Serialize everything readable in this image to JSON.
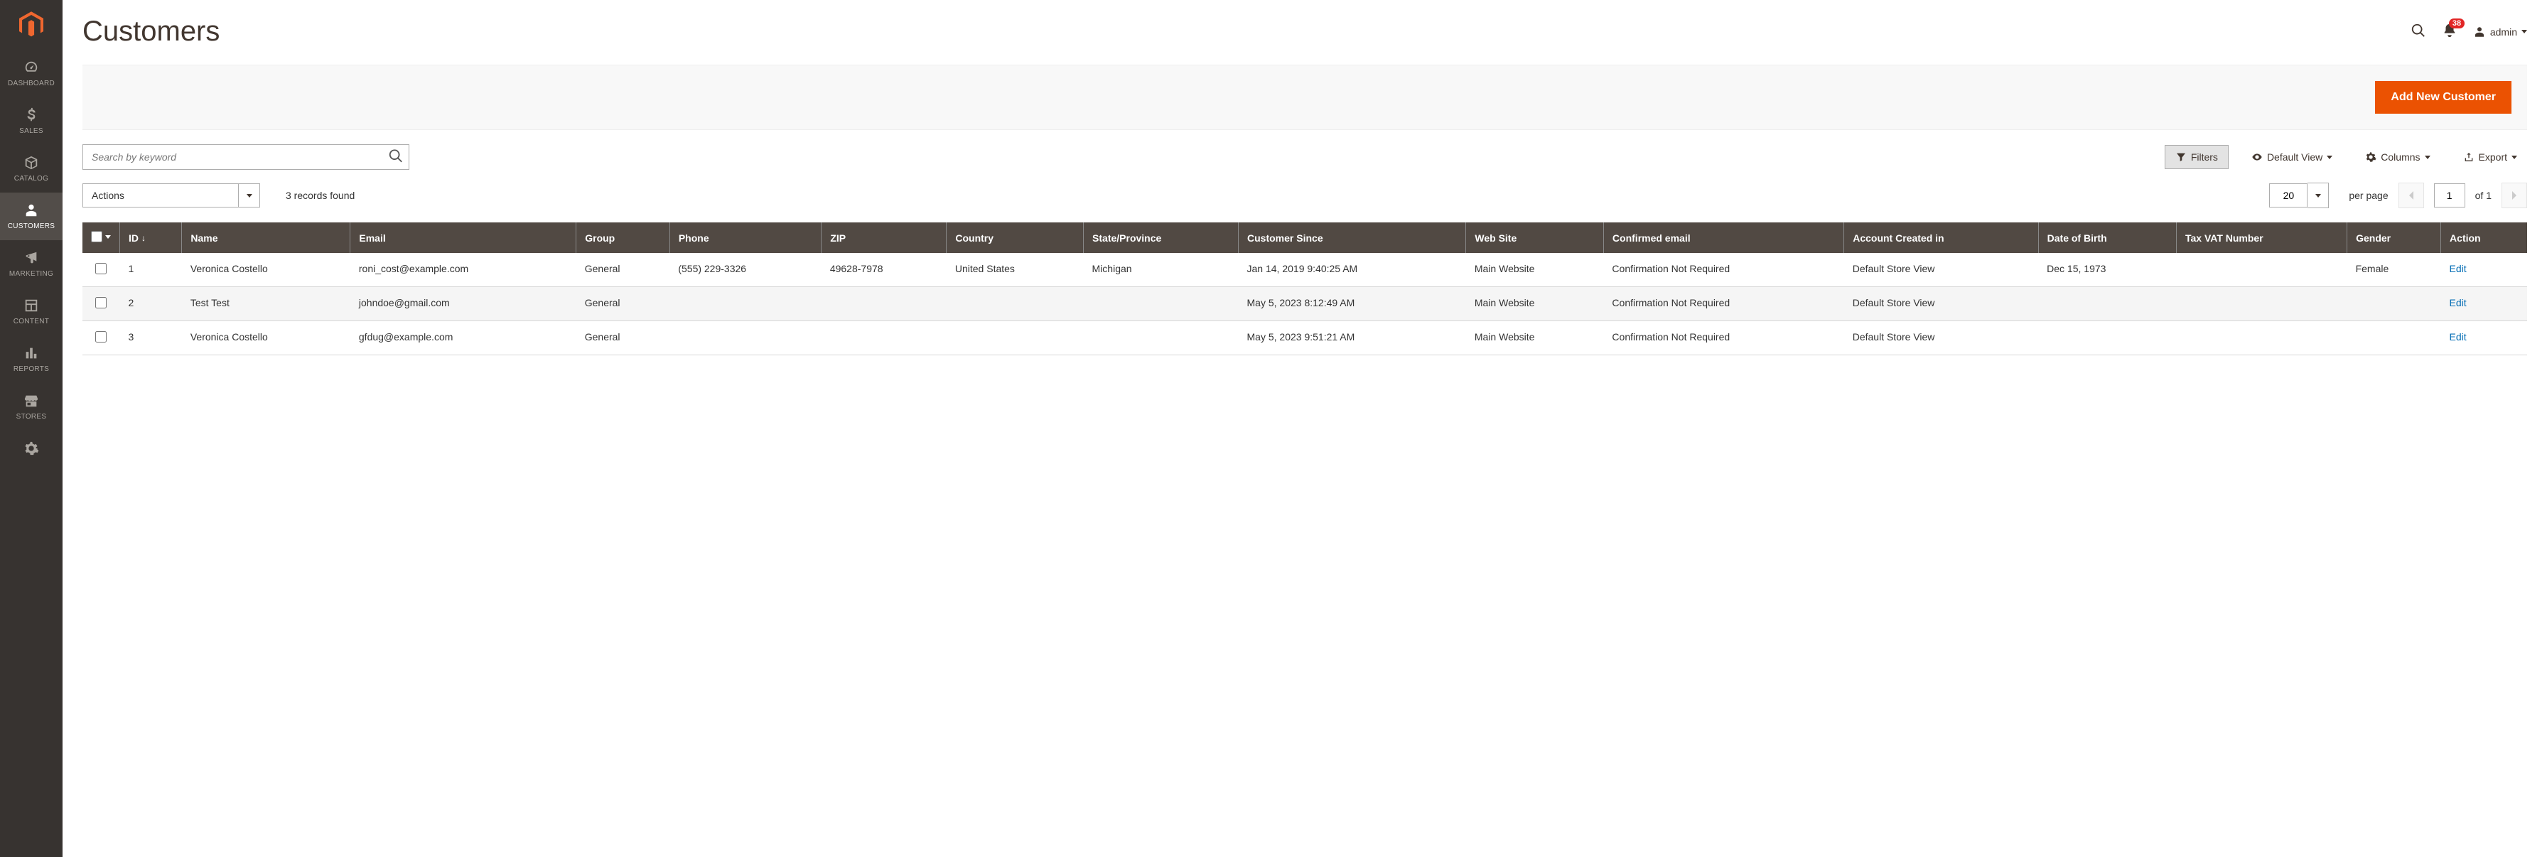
{
  "sidebar": {
    "items": [
      {
        "key": "dashboard",
        "label": "DASHBOARD"
      },
      {
        "key": "sales",
        "label": "SALES"
      },
      {
        "key": "catalog",
        "label": "CATALOG"
      },
      {
        "key": "customers",
        "label": "CUSTOMERS"
      },
      {
        "key": "marketing",
        "label": "MARKETING"
      },
      {
        "key": "content",
        "label": "CONTENT"
      },
      {
        "key": "reports",
        "label": "REPORTS"
      },
      {
        "key": "stores",
        "label": "STORES"
      },
      {
        "key": "system",
        "label": ""
      }
    ]
  },
  "header": {
    "title": "Customers",
    "notif_count": "38",
    "admin_label": "admin"
  },
  "primary_action": {
    "label": "Add New Customer"
  },
  "search": {
    "placeholder": "Search by keyword"
  },
  "toolbar": {
    "filters": "Filters",
    "default_view": "Default View",
    "columns": "Columns",
    "export": "Export"
  },
  "listing": {
    "actions_label": "Actions",
    "records_found": "3 records found",
    "per_page_value": "20",
    "per_page_label": "per page",
    "page_value": "1",
    "page_of": "of 1"
  },
  "columns": {
    "id": "ID",
    "name": "Name",
    "email": "Email",
    "group": "Group",
    "phone": "Phone",
    "zip": "ZIP",
    "country": "Country",
    "state": "State/Province",
    "since": "Customer Since",
    "website": "Web Site",
    "confirmed": "Confirmed email",
    "created_in": "Account Created in",
    "dob": "Date of Birth",
    "vat": "Tax VAT Number",
    "gender": "Gender",
    "action": "Action"
  },
  "rows": [
    {
      "id": "1",
      "name": "Veronica Costello",
      "email": "roni_cost@example.com",
      "group": "General",
      "phone": "(555) 229-3326",
      "zip": "49628-7978",
      "country": "United States",
      "state": "Michigan",
      "since": "Jan 14, 2019 9:40:25 AM",
      "website": "Main Website",
      "confirmed": "Confirmation Not Required",
      "created_in": "Default Store View",
      "dob": "Dec 15, 1973",
      "vat": "",
      "gender": "Female",
      "action": "Edit"
    },
    {
      "id": "2",
      "name": "Test Test",
      "email": "johndoe@gmail.com",
      "group": "General",
      "phone": "",
      "zip": "",
      "country": "",
      "state": "",
      "since": "May 5, 2023 8:12:49 AM",
      "website": "Main Website",
      "confirmed": "Confirmation Not Required",
      "created_in": "Default Store View",
      "dob": "",
      "vat": "",
      "gender": "",
      "action": "Edit"
    },
    {
      "id": "3",
      "name": "Veronica Costello",
      "email": "gfdug@example.com",
      "group": "General",
      "phone": "",
      "zip": "",
      "country": "",
      "state": "",
      "since": "May 5, 2023 9:51:21 AM",
      "website": "Main Website",
      "confirmed": "Confirmation Not Required",
      "created_in": "Default Store View",
      "dob": "",
      "vat": "",
      "gender": "",
      "action": "Edit"
    }
  ]
}
